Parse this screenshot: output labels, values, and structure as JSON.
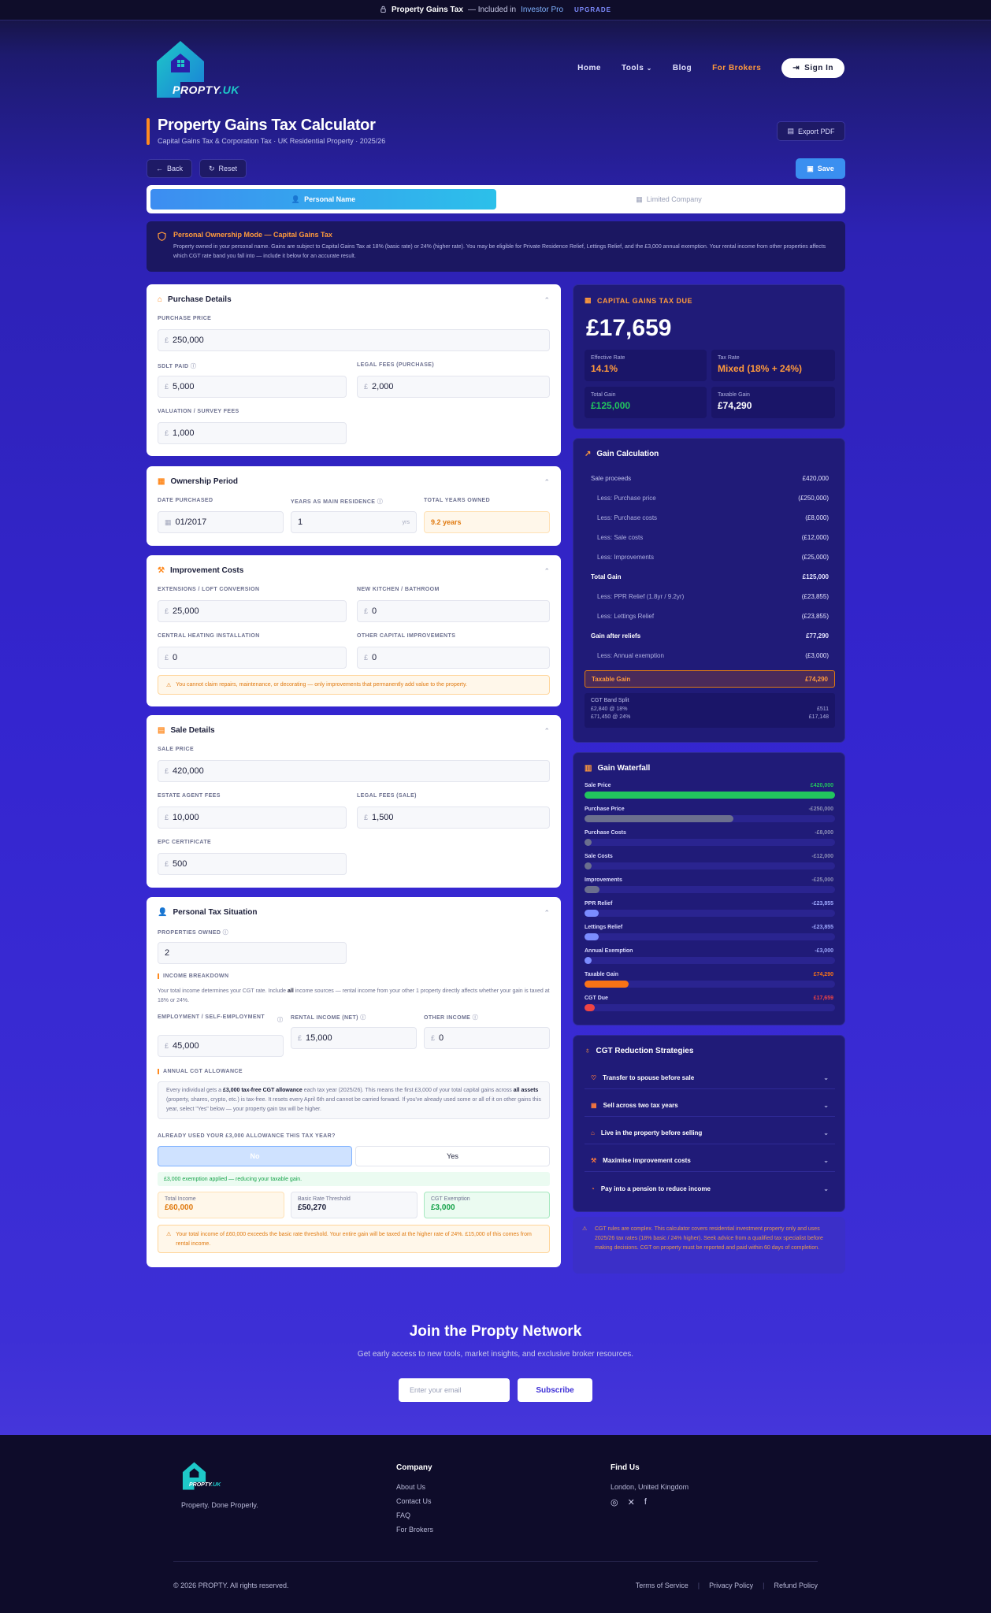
{
  "topbar": {
    "product": "Property Gains Tax",
    "included_prefix": "— Included in",
    "plan": "Investor Pro",
    "upgrade": "UPGRADE"
  },
  "brand": {
    "name": "PROPTY",
    "suffix": ".UK",
    "tagline": "Property. Done Properly."
  },
  "nav": {
    "home": "Home",
    "tools": "Tools",
    "blog": "Blog",
    "brokers": "For Brokers",
    "signin": "Sign In"
  },
  "page": {
    "title": "Property Gains Tax Calculator",
    "subtitle": "Capital Gains Tax & Corporation Tax · UK Residential Property · 2025/26",
    "export": "Export PDF",
    "back": "Back",
    "reset": "Reset",
    "save": "Save"
  },
  "mode": {
    "personal": "Personal Name",
    "company": "Limited Company"
  },
  "notice": {
    "title": "Personal Ownership Mode — Capital Gains Tax",
    "text": "Property owned in your personal name. Gains are subject to Capital Gains Tax at 18% (basic rate) or 24% (higher rate). You may be eligible for Private Residence Relief, Lettings Relief, and the £3,000 annual exemption. Your rental income from other properties affects which CGT rate band you fall into — include it below for an accurate result."
  },
  "purchase": {
    "title": "Purchase Details",
    "price_label": "PURCHASE PRICE",
    "price": "250,000",
    "sdlt_label": "SDLT PAID",
    "sdlt": "5,000",
    "legal_label": "LEGAL FEES (PURCHASE)",
    "legal": "2,000",
    "valuation_label": "VALUATION / SURVEY FEES",
    "valuation": "1,000",
    "currency": "£"
  },
  "ownership": {
    "title": "Ownership Period",
    "date_label": "DATE PURCHASED",
    "date": "01/2017",
    "years_res_label": "YEARS AS MAIN RESIDENCE",
    "years_res": "1",
    "yrs": "yrs",
    "total_label": "TOTAL YEARS OWNED",
    "total": "9.2 years"
  },
  "improvements": {
    "title": "Improvement Costs",
    "ext_label": "EXTENSIONS / LOFT CONVERSION",
    "ext": "25,000",
    "kitchen_label": "NEW KITCHEN / BATHROOM",
    "kitchen": "0",
    "heating_label": "CENTRAL HEATING INSTALLATION",
    "heating": "0",
    "other_label": "OTHER CAPITAL IMPROVEMENTS",
    "other": "0",
    "warning": "You cannot claim repairs, maintenance, or decorating — only improvements that permanently add value to the property."
  },
  "sale": {
    "title": "Sale Details",
    "price_label": "SALE PRICE",
    "price": "420,000",
    "agent_label": "ESTATE AGENT FEES",
    "agent": "10,000",
    "legal_label": "LEGAL FEES (SALE)",
    "legal": "1,500",
    "epc_label": "EPC CERTIFICATE",
    "epc": "500"
  },
  "personal": {
    "title": "Personal Tax Situation",
    "props_label": "PROPERTIES OWNED",
    "props": "2",
    "income_title": "INCOME BREAKDOWN",
    "income_text_a": "Your total income determines your CGT rate. Include",
    "income_text_b": "all",
    "income_text_c": "income sources — rental income from your other 1 property directly affects whether your gain is taxed at 18% or 24%.",
    "emp_label": "EMPLOYMENT / SELF-EMPLOYMENT",
    "emp": "45,000",
    "rental_label": "RENTAL INCOME (NET)",
    "rental": "15,000",
    "other_label": "OTHER INCOME",
    "other": "0",
    "allow_title": "ANNUAL CGT ALLOWANCE",
    "allow_a": "Every individual gets a",
    "allow_b": "£3,000 tax-free CGT allowance",
    "allow_c": "each tax year (2025/26). This means the first £3,000 of your total capital gains across",
    "allow_d": "all assets",
    "allow_e": "(property, shares, crypto, etc.) is tax-free. It resets every April 6th and cannot be carried forward. If you've already used some or all of it on other gains this year, select \"Yes\" below — your property gain tax will be higher.",
    "used_q": "ALREADY USED YOUR £3,000 ALLOWANCE THIS TAX YEAR?",
    "no": "No",
    "yes": "Yes",
    "applied": "£3,000 exemption applied — reducing your taxable gain.",
    "ti_label": "Total Income",
    "ti": "£60,000",
    "brt_label": "Basic Rate Threshold",
    "brt": "£50,270",
    "ce_label": "CGT Exemption",
    "ce": "£3,000",
    "warn": "Your total income of £60,000 exceeds the basic rate threshold. Your entire gain will be taxed at the higher rate of 24%. £15,000 of this comes from rental income."
  },
  "cgt": {
    "title": "CAPITAL GAINS TAX DUE",
    "amount": "£17,659",
    "eff_label": "Effective Rate",
    "eff": "14.1%",
    "rate_label": "Tax Rate",
    "rate": "Mixed (18% + 24%)",
    "tg_label": "Total Gain",
    "tg": "£125,000",
    "tx_label": "Taxable Gain",
    "tx": "£74,290"
  },
  "calc": {
    "title": "Gain Calculation",
    "rows": [
      {
        "l": "Sale proceeds",
        "v": "£420,000",
        "t": "n"
      },
      {
        "l": "Less: Purchase price",
        "v": "(£250,000)",
        "t": "i"
      },
      {
        "l": "Less: Purchase costs",
        "v": "(£8,000)",
        "t": "i"
      },
      {
        "l": "Less: Sale costs",
        "v": "(£12,000)",
        "t": "i"
      },
      {
        "l": "Less: Improvements",
        "v": "(£25,000)",
        "t": "i"
      },
      {
        "l": "Total Gain",
        "v": "£125,000",
        "t": "b"
      },
      {
        "l": "Less: PPR Relief (1.8yr / 9.2yr)",
        "v": "(£23,855)",
        "t": "i"
      },
      {
        "l": "Less: Lettings Relief",
        "v": "(£23,855)",
        "t": "i"
      },
      {
        "l": "Gain after reliefs",
        "v": "£77,290",
        "t": "b"
      },
      {
        "l": "Less: Annual exemption",
        "v": "(£3,000)",
        "t": "i"
      }
    ],
    "taxable_label": "Taxable Gain",
    "taxable": "£74,290",
    "band_title": "CGT Band Split",
    "band1": "£2,840 @ 18%",
    "band1v": "£511",
    "band2": "£71,450 @ 24%",
    "band2v": "£17,148"
  },
  "waterfall": {
    "title": "Gain Waterfall",
    "items": [
      {
        "label": "Sale Price",
        "value": "£420,000",
        "frac": 1.0,
        "color": "#22c55e",
        "vc": "#22c55e"
      },
      {
        "label": "Purchase Price",
        "value": "-£250,000",
        "frac": 0.595,
        "color": "#6b6f8e",
        "vc": "#8c8fb6"
      },
      {
        "label": "Purchase Costs",
        "value": "-£8,000",
        "frac": 0.019,
        "color": "#6b6f8e",
        "vc": "#8c8fb6"
      },
      {
        "label": "Sale Costs",
        "value": "-£12,000",
        "frac": 0.029,
        "color": "#6b6f8e",
        "vc": "#8c8fb6"
      },
      {
        "label": "Improvements",
        "value": "-£25,000",
        "frac": 0.06,
        "color": "#6b6f8e",
        "vc": "#8c8fb6"
      },
      {
        "label": "PPR Relief",
        "value": "-£23,855",
        "frac": 0.057,
        "color": "#7b8cff",
        "vc": "#9ea9ff"
      },
      {
        "label": "Lettings Relief",
        "value": "-£23,855",
        "frac": 0.057,
        "color": "#7b8cff",
        "vc": "#9ea9ff"
      },
      {
        "label": "Annual Exemption",
        "value": "-£3,000",
        "frac": 0.007,
        "color": "#7b8cff",
        "vc": "#9ea9ff"
      },
      {
        "label": "Taxable Gain",
        "value": "£74,290",
        "frac": 0.177,
        "color": "#f97316",
        "vc": "#f97316"
      },
      {
        "label": "CGT Due",
        "value": "£17,659",
        "frac": 0.042,
        "color": "#ef4444",
        "vc": "#ef4444"
      }
    ]
  },
  "strategies": {
    "title": "CGT Reduction Strategies",
    "items": [
      "Transfer to spouse before sale",
      "Sell across two tax years",
      "Live in the property before selling",
      "Maximise improvement costs",
      "Pay into a pension to reduce income"
    ]
  },
  "disclaimer": "CGT rules are complex. This calculator covers residential investment property only and uses 2025/26 tax rates (18% basic / 24% higher). Seek advice from a qualified tax specialist before making decisions. CGT on property must be reported and paid within 60 days of completion.",
  "join": {
    "title": "Join the Propty Network",
    "text": "Get early access to new tools, market insights, and exclusive broker resources.",
    "placeholder": "Enter your email",
    "subscribe": "Subscribe"
  },
  "footer": {
    "company": "Company",
    "links": [
      "About Us",
      "Contact Us",
      "FAQ",
      "For Brokers"
    ],
    "find": "Find Us",
    "location": "London, United Kingdom",
    "copy": "© 2026 PROPTY. All rights reserved.",
    "terms": "Terms of Service",
    "privacy": "Privacy Policy",
    "refund": "Refund Policy"
  }
}
